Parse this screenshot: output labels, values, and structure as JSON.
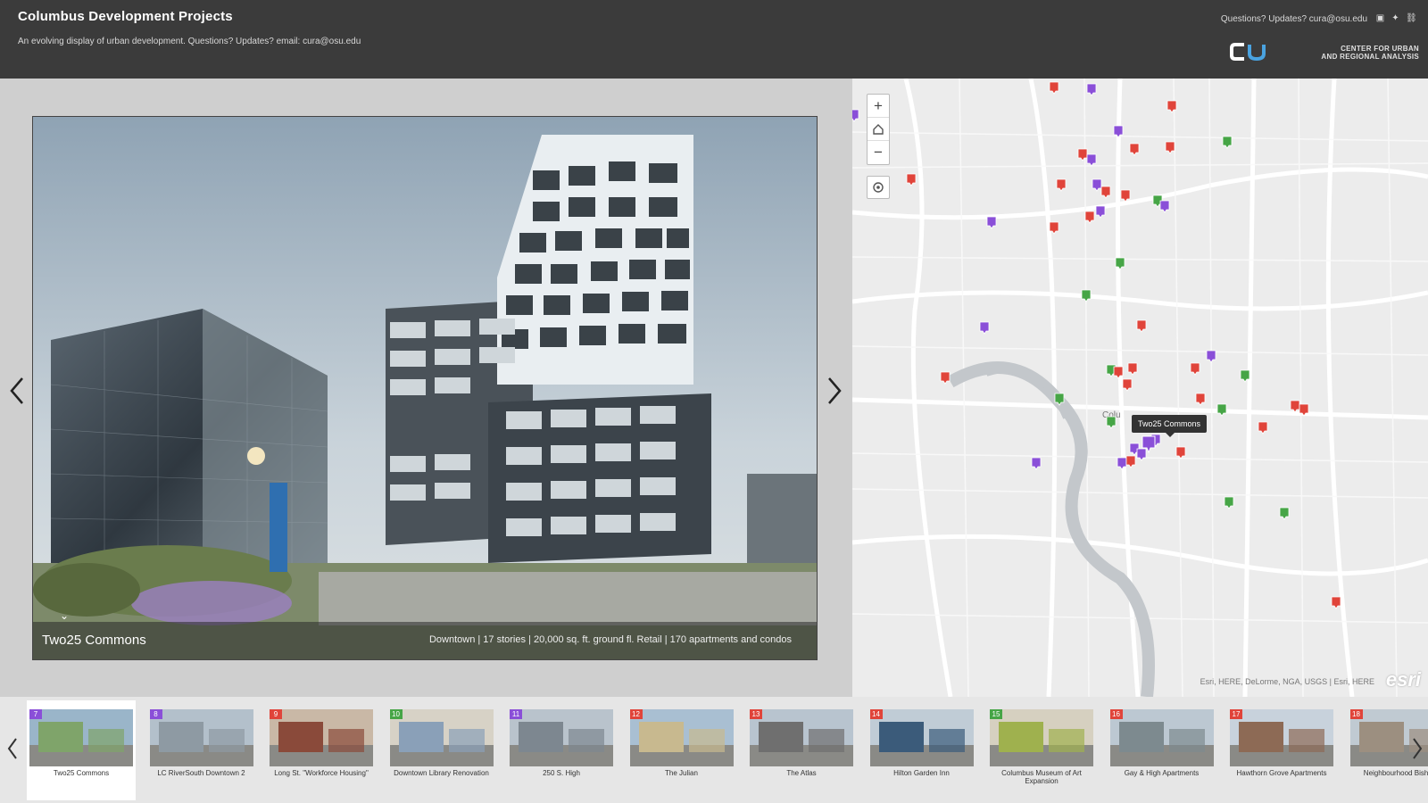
{
  "header": {
    "title": "Columbus Development Projects",
    "subtitle": "An evolving display of urban development. Questions? Updates? email: cura@osu.edu",
    "contact": "Questions? Updates? cura@osu.edu",
    "social_icons": [
      "facebook-icon",
      "twitter-icon",
      "link-icon"
    ],
    "logo_text": "CU",
    "org_name_line1": "CENTER FOR URBAN",
    "org_name_line2": "AND REGIONAL ANALYSIS"
  },
  "photo": {
    "name": "Two25 Commons",
    "description": "Downtown | 17 stories | 20,000 sq. ft. ground fl. Retail | 170 apartments and condos",
    "toggle_icon": "chevron-down-icon"
  },
  "map": {
    "tooltip": "Two25 Commons",
    "attribution": "Esri, HERE, DeLorme, NGA, USGS | Esri, HERE",
    "esri_logo": "esri",
    "city_label": "Colu",
    "controls": {
      "zoom_in": "+",
      "home": "home-icon",
      "zoom_out": "−",
      "locate": "locate-icon"
    },
    "marker_colors": {
      "red": "#e0443a",
      "purple": "#8a4fd8",
      "green": "#46a546"
    }
  },
  "thumbnails": [
    {
      "num": "7",
      "color": "#8a4fd8",
      "label": "Two25 Commons",
      "active": true
    },
    {
      "num": "8",
      "color": "#8a4fd8",
      "label": "LC RiverSouth Downtown 2"
    },
    {
      "num": "9",
      "color": "#e0443a",
      "label": "Long St. \"Workforce Housing\""
    },
    {
      "num": "10",
      "color": "#46a546",
      "label": "Downtown Library Renovation"
    },
    {
      "num": "11",
      "color": "#8a4fd8",
      "label": "250 S. High"
    },
    {
      "num": "12",
      "color": "#e0443a",
      "label": "The Julian"
    },
    {
      "num": "13",
      "color": "#e0443a",
      "label": "The Atlas"
    },
    {
      "num": "14",
      "color": "#e0443a",
      "label": "Hilton Garden Inn"
    },
    {
      "num": "15",
      "color": "#46a546",
      "label": "Columbus Museum of Art Expansion"
    },
    {
      "num": "16",
      "color": "#e0443a",
      "label": "Gay & High Apartments"
    },
    {
      "num": "17",
      "color": "#e0443a",
      "label": "Hawthorn Grove Apartments"
    },
    {
      "num": "18",
      "color": "#e0443a",
      "label": "Neighbourhood Bishops"
    }
  ]
}
